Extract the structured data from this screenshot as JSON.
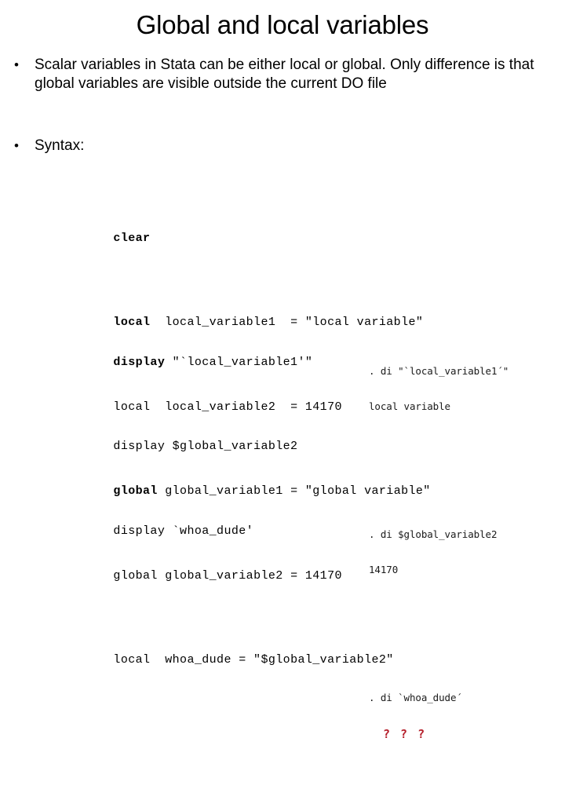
{
  "slide": {
    "title": "Global and local variables",
    "bullet_marker": "•"
  },
  "bullets": [
    {
      "id": "scalar",
      "text": "Scalar variables in Stata can be either local or global.  Only difference is that global variables are visible outside the current DO file"
    },
    {
      "id": "syntax",
      "text": "Syntax:"
    }
  ],
  "code": {
    "declarations": [
      {
        "keyword": "clear",
        "bold": false,
        "rest": ""
      },
      {
        "keyword": "local",
        "bold": true,
        "rest": "  local_variable1  = \"local variable\""
      },
      {
        "keyword": "local",
        "bold": false,
        "rest": "  local_variable2  = 14170"
      },
      {
        "keyword": "global",
        "bold": true,
        "rest": " global_variable1 = \"global variable\""
      },
      {
        "keyword": "global",
        "bold": false,
        "rest": " global_variable2 = 14170"
      },
      {
        "keyword": "local",
        "bold": false,
        "rest": "  whoa_dude = \"$global_variable2\""
      }
    ],
    "display": [
      {
        "keyword": "display",
        "bold": true,
        "rest": " \"`local_variable1'\""
      },
      {
        "keyword": "display",
        "bold": false,
        "rest": " $global_variable2"
      },
      {
        "keyword": "display",
        "bold": false,
        "rest": " `whoa_dude'"
      }
    ]
  },
  "console": {
    "groups": [
      {
        "command": ". di \"`local_variable1´\"",
        "output": "local variable",
        "output_color": "#1a1a1a"
      },
      {
        "command": ". di $global_variable2",
        "output": "14170",
        "output_color": "#1a1a1a"
      },
      {
        "command": ". di `whoa_dude´",
        "output": "? ? ?",
        "output_color": "#b51f2b"
      }
    ]
  },
  "colors": {
    "background": "#ffffff",
    "text": "#000000",
    "console_text": "#1a1a1a",
    "error_red": "#b51f2b"
  }
}
